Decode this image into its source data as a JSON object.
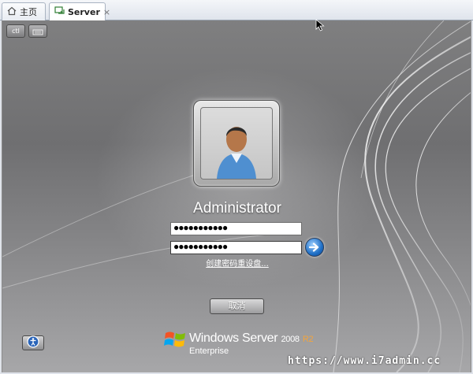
{
  "tabs": [
    {
      "label": "主页",
      "icon": "home-icon"
    },
    {
      "label": "Server",
      "icon": "vm-console-icon",
      "close": "×"
    }
  ],
  "toolbar": {
    "buttons": [
      {
        "icon": "ctrl-alt-del-icon",
        "label": "ctl"
      },
      {
        "icon": "keyboard-icon"
      }
    ]
  },
  "login": {
    "username": "Administrator",
    "password_masked": "●●●●●●●●●●●",
    "new_password_masked": "●●●●●●●●●●●",
    "reset_link": "创建密码重设盘...",
    "submit_icon": "arrow-right-icon"
  },
  "cancel_button": "取消",
  "ease_of_access_icon": "ease-of-access-icon",
  "branding": {
    "product": "Windows Server",
    "version": "2008",
    "release": "R2",
    "edition": "Enterprise"
  },
  "watermark": "https://www.i7admin.cc",
  "colors": {
    "background": "#7a7a7c",
    "text": "#ffffff",
    "accent_r2": "#f3a43c",
    "submit_blue": "#1f6fc6"
  }
}
